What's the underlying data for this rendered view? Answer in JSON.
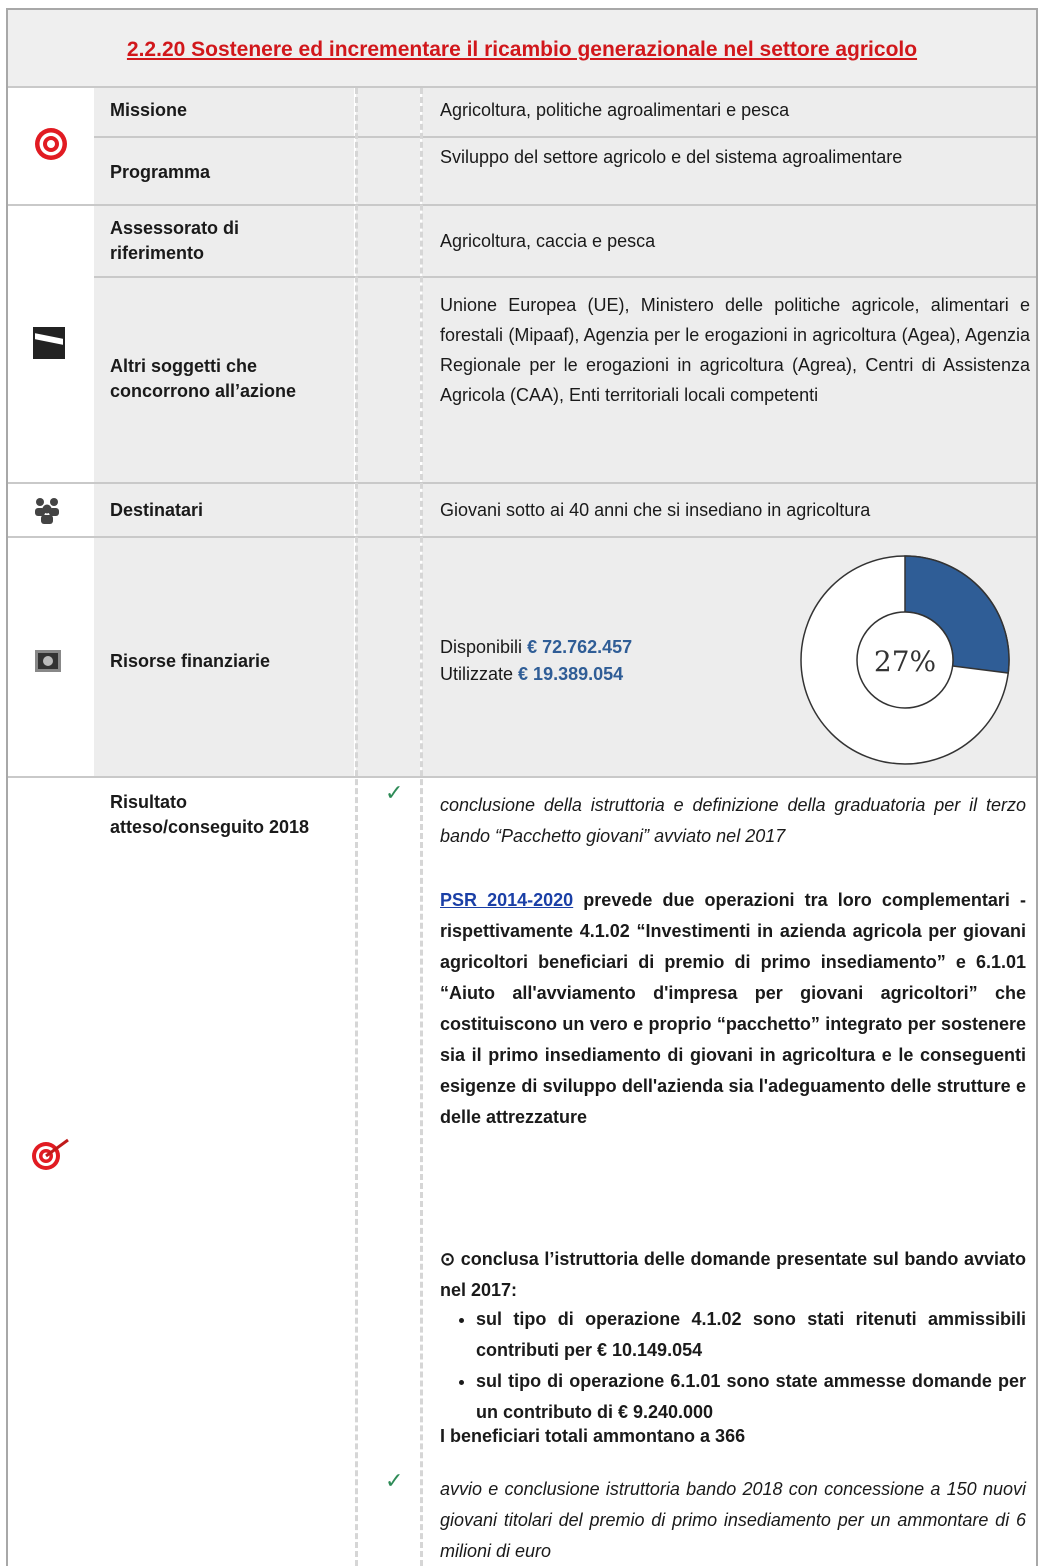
{
  "title": "2.2.20 Sostenere ed incrementare il ricambio generazionale nel settore agricolo",
  "rows": {
    "missione": {
      "label": "Missione",
      "value": "Agricoltura, politiche agroalimentari e pesca"
    },
    "programma": {
      "label": "Programma",
      "value": "Sviluppo del settore agricolo e del sistema agroalimentare"
    },
    "assessorato": {
      "label": "Assessorato di riferimento",
      "value": "Agricoltura, caccia e pesca"
    },
    "altri": {
      "label": "Altri soggetti che concorrono all’azione",
      "value": "Unione Europea (UE), Ministero delle politiche agricole, alimentari e forestali (Mipaaf), Agenzia per le erogazioni in agricoltura (Agea), Agenzia Regionale per le erogazioni in agricoltura (Agrea), Centri di Assistenza Agricola (CAA), Enti territoriali locali competenti"
    },
    "destinatari": {
      "label": "Destinatari",
      "value": "Giovani sotto ai 40 anni che si insediano in agricoltura"
    },
    "risorse": {
      "label": "Risorse finanziarie",
      "disponibili_label": "Disponibili",
      "disponibili_value": "€ 72.762.457",
      "utilizzate_label": "Utilizzate",
      "utilizzate_value": "€ 19.389.054",
      "percent_label": "27%",
      "percent": 0.27
    },
    "risultato": {
      "label": "Risultato atteso/conseguito 2018",
      "item1": "conclusione della istruttoria e definizione della graduatoria per il terzo bando “Pacchetto giovani” avviato nel 2017",
      "psr_link": "PSR 2014-2020",
      "psr_text": " prevede due operazioni tra loro complementari - rispettivamente 4.1.02 “Investimenti in azienda agricola per giovani agricoltori beneficiari di premio di primo insediamento” e 6.1.01 “Aiuto all'avviamento d'impresa per giovani agricoltori” che costituiscono un vero e proprio “pacchetto” integrato per sostenere sia il primo insediamento di giovani in agricoltura e le conseguenti esigenze di sviluppo dell'azienda sia l'adeguamento delle strutture e delle attrezzature",
      "conclusa": "conclusa l’istruttoria delle domande presentate sul bando avviato nel 2017:",
      "bullet1": "sul tipo di operazione 4.1.02 sono stati ritenuti ammissibili contributi per € 10.149.054",
      "bullet2": "sul tipo di operazione 6.1.01 sono state ammesse domande per un contributo di € 9.240.000",
      "beneficiari": "I beneficiari totali ammontano a 366",
      "item2": "avvio e conclusione istruttoria bando 2018 con concessione a 150 nuovi giovani titolari del premio di primo insediamento per un ammontare di 6 milioni di euro"
    }
  },
  "icons": [
    "target-icon",
    "flag-icon",
    "people-icon",
    "money-icon",
    "target-dart-icon",
    "check-icon"
  ],
  "colors": {
    "title": "#d1171b",
    "amount": "#2f5d96",
    "chart_fill": "#2f5d96",
    "check": "#2e8b57"
  }
}
